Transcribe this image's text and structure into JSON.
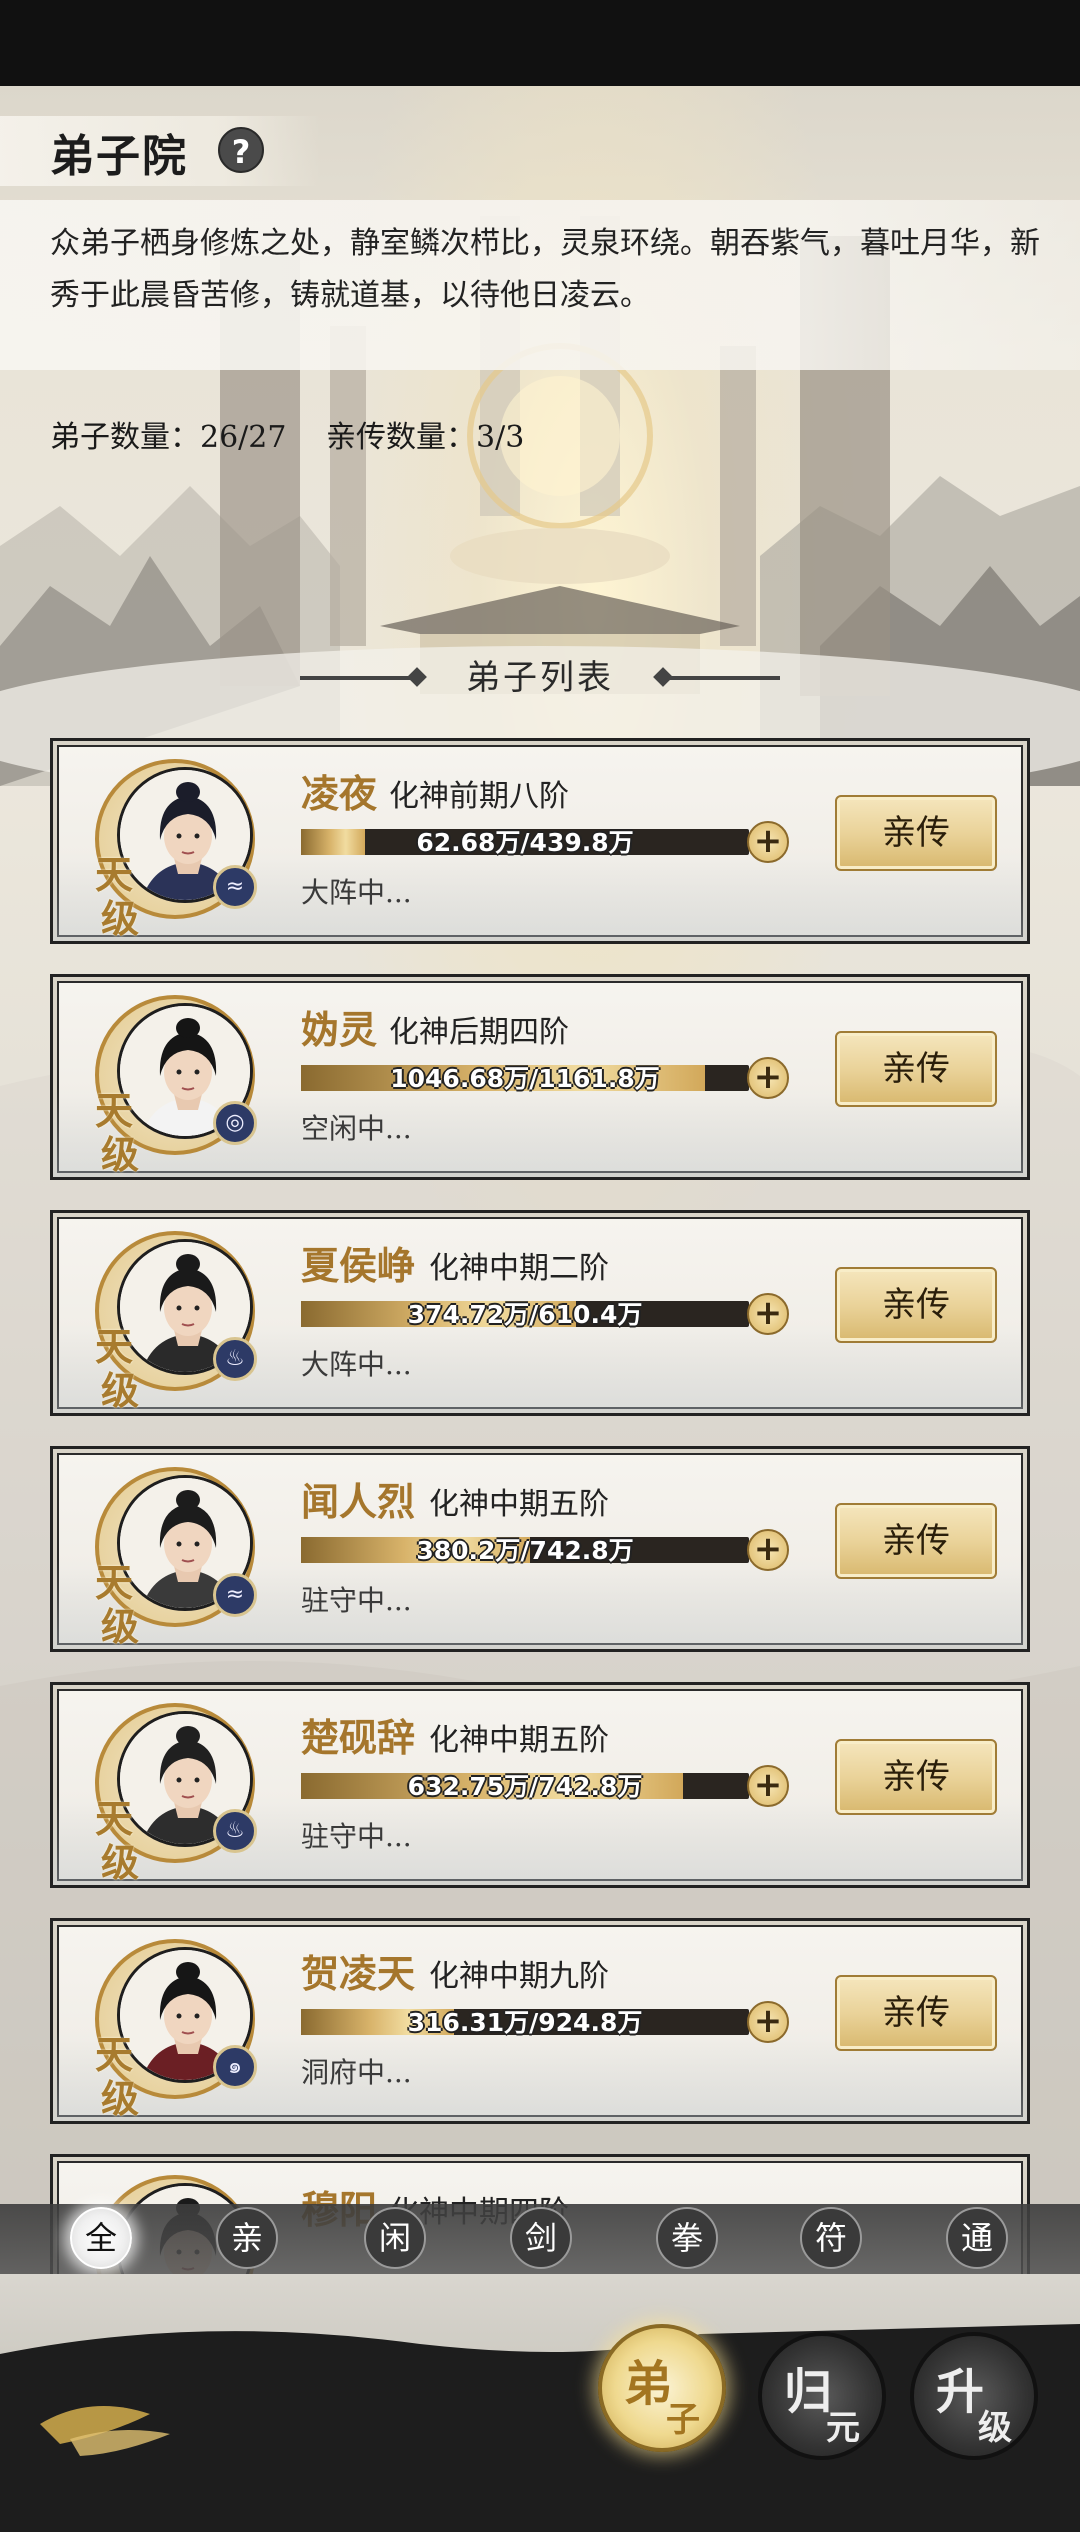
{
  "header": {
    "title": "弟子院",
    "help_icon": "question-icon",
    "description": "众弟子栖身修炼之处，静室鳞次栉比，灵泉环绕。朝吞紫气，暮吐月华，新秀于此晨昏苦修，铸就道基，以待他日凌云。",
    "disciple_count": "弟子数量：26/27",
    "inner_count": "亲传数量：3/3"
  },
  "list": {
    "title": "弟子列表",
    "items": [
      {
        "name": "凌夜",
        "realm": "化神前期八阶",
        "progress_text": "62.68万/439.8万",
        "progress": 0.1425,
        "status": "大阵中...",
        "grade_1": "天",
        "grade_2": "级",
        "element_icon": "water-icon",
        "action": "亲传"
      },
      {
        "name": "妫灵",
        "realm": "化神后期四阶",
        "progress_text": "1046.68万/1161.8万",
        "progress": 0.901,
        "status": "空闲中...",
        "grade_1": "天",
        "grade_2": "级",
        "element_icon": "swirl-icon",
        "action": "亲传"
      },
      {
        "name": "夏侯峥",
        "realm": "化神中期二阶",
        "progress_text": "374.72万/610.4万",
        "progress": 0.614,
        "status": "大阵中...",
        "grade_1": "天",
        "grade_2": "级",
        "element_icon": "flame-icon",
        "action": "亲传"
      },
      {
        "name": "闻人烈",
        "realm": "化神中期五阶",
        "progress_text": "380.2万/742.8万",
        "progress": 0.512,
        "status": "驻守中...",
        "grade_1": "天",
        "grade_2": "级",
        "element_icon": "water-icon",
        "action": "亲传"
      },
      {
        "name": "楚砚辞",
        "realm": "化神中期五阶",
        "progress_text": "632.75万/742.8万",
        "progress": 0.852,
        "status": "驻守中...",
        "grade_1": "天",
        "grade_2": "级",
        "element_icon": "flame-icon",
        "action": "亲传"
      },
      {
        "name": "贺凌天",
        "realm": "化神中期九阶",
        "progress_text": "316.31万/924.8万",
        "progress": 0.342,
        "status": "洞府中...",
        "grade_1": "天",
        "grade_2": "级",
        "element_icon": "fire-spiral-icon",
        "action": "亲传"
      },
      {
        "name": "穆阳",
        "realm": "化神中期四阶"
      }
    ]
  },
  "filters": [
    "全",
    "亲",
    "闲",
    "剑",
    "拳",
    "符",
    "通"
  ],
  "active_filter": "全",
  "bottom_nav": {
    "disciple": {
      "big": "弟",
      "small": "子"
    },
    "guiyuan": {
      "big": "归",
      "small": "元"
    },
    "upgrade": {
      "big": "升",
      "small": "级"
    }
  },
  "colors": {
    "accent_gold": "#a5762c",
    "button_gold": "#ead39a",
    "card_bg": "#f1eee8"
  }
}
